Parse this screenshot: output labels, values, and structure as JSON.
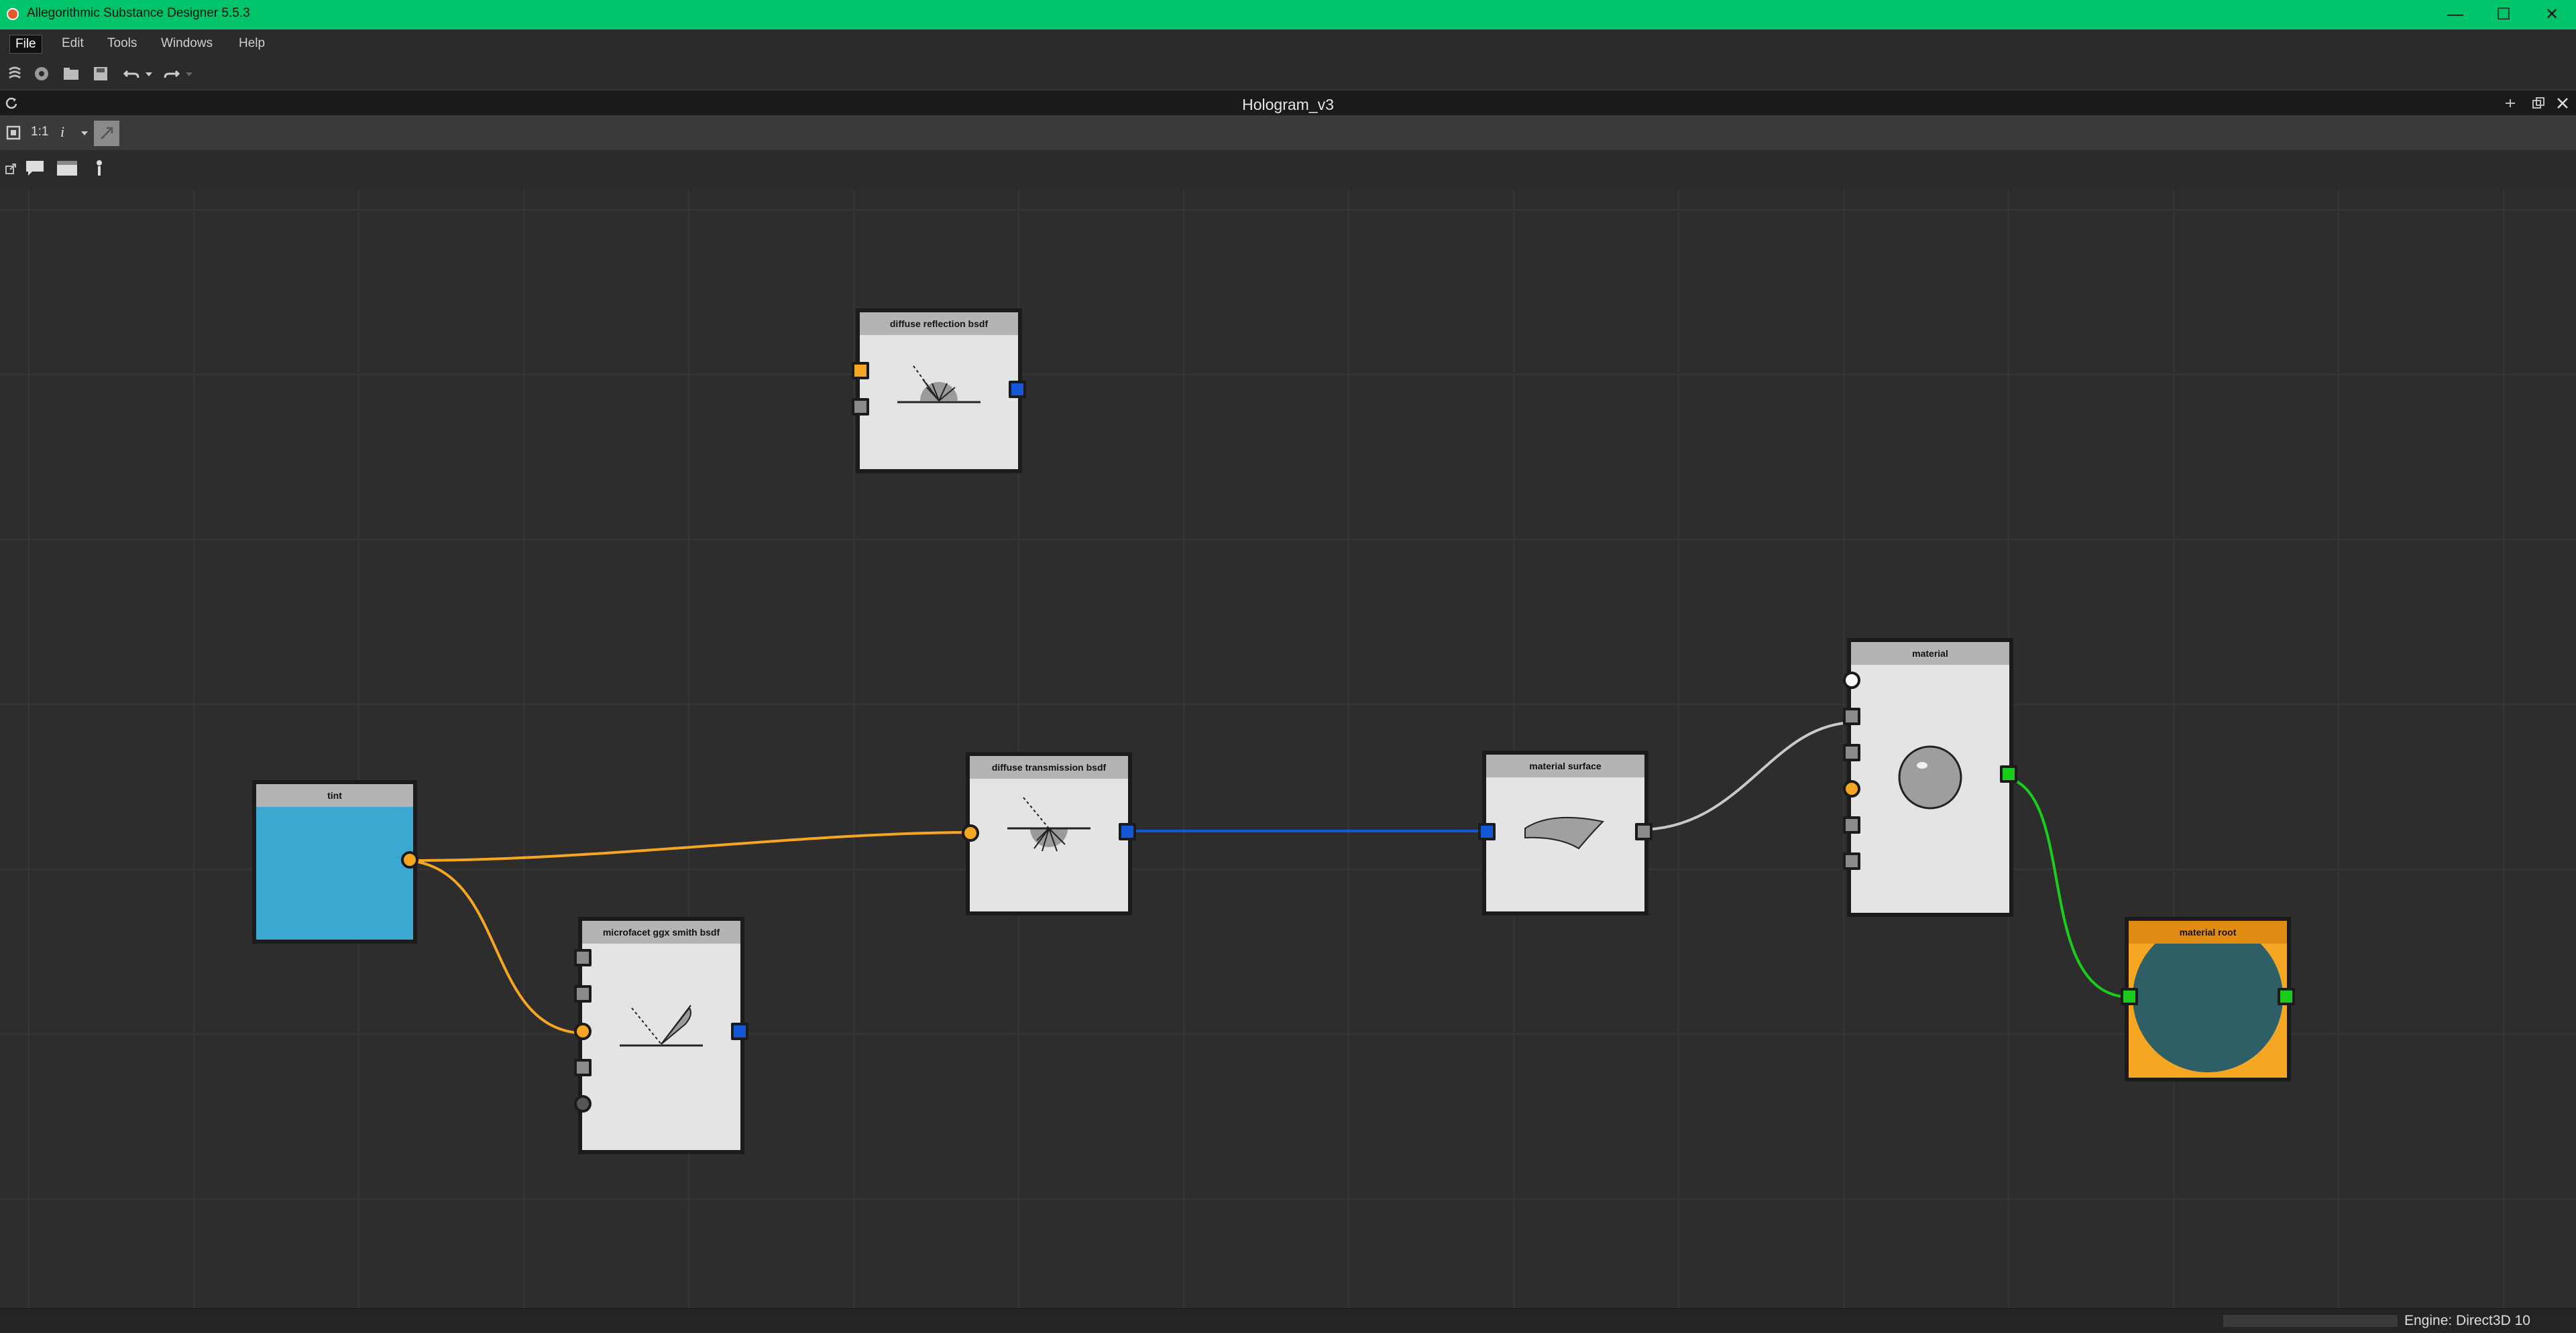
{
  "window": {
    "title": "Allegorithmic Substance Designer 5.5.3",
    "minimize": "—",
    "maximize": "☐",
    "close": "✕"
  },
  "menu": [
    "File",
    "Edit",
    "Tools",
    "Windows",
    "Help"
  ],
  "document": {
    "title": "Hologram_v3"
  },
  "graph_toolbar": {
    "zoom_label": "1:1",
    "info_label": "i"
  },
  "nodes": {
    "diffuse_reflection": "diffuse reflection bsdf",
    "diffuse_transmission": "diffuse transmission bsdf",
    "tint": "tint",
    "microfacet": "microfacet ggx smith bsdf",
    "material_surface": "material surface",
    "material": "material",
    "material_root": "material root"
  },
  "colors": {
    "titlebar": "#00c46a",
    "tint_swatch": "#3aa8d0",
    "float_port": "#f5a623",
    "bsdf_port": "#1558d6",
    "material_port": "#1ccc1c",
    "material_root_header": "#e89a1a"
  },
  "status": {
    "engine": "Engine: Direct3D 10"
  }
}
